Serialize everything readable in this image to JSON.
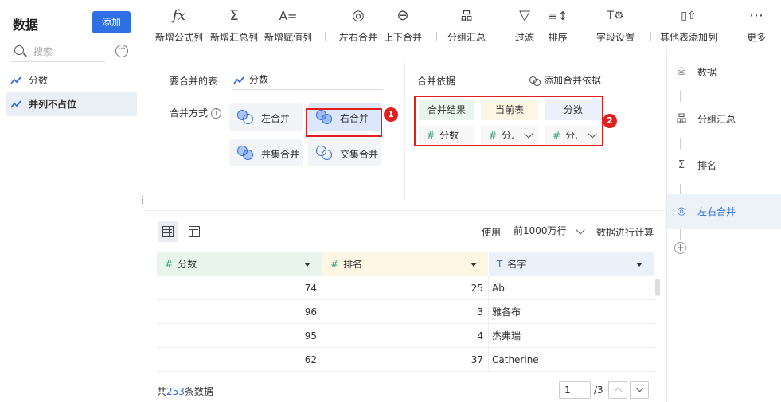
{
  "left_panel": {
    "title": "数据",
    "add_label": "添加",
    "search_placeholder": "搜索",
    "items": [
      {
        "label": "分数",
        "selected": false
      },
      {
        "label": "并列不占位",
        "selected": true
      }
    ]
  },
  "toolbar": {
    "items": [
      {
        "icon": "function-icon",
        "glyph": "fx",
        "label": "新增公式列"
      },
      {
        "icon": "sigma-icon",
        "glyph": "Σ",
        "label": "新增汇总列"
      },
      {
        "icon": "assign-value-icon",
        "glyph": "A=",
        "label": "新增赋值列"
      },
      {
        "icon": "left-right-merge-icon",
        "glyph": "◎",
        "label": "左右合并"
      },
      {
        "icon": "up-down-merge-icon",
        "glyph": "⊖",
        "label": "上下合并"
      },
      {
        "icon": "group-summary-icon",
        "glyph": "品",
        "label": "分组汇总"
      },
      {
        "icon": "filter-icon",
        "glyph": "▽",
        "label": "过滤"
      },
      {
        "icon": "sort-icon",
        "glyph": "≡↕",
        "label": "排序"
      },
      {
        "icon": "field-settings-icon",
        "glyph": "T⚙",
        "label": "字段设置"
      },
      {
        "icon": "add-column-from-other-table-icon",
        "glyph": "▯⇧",
        "label": "其他表添加列"
      },
      {
        "icon": "more-icon",
        "glyph": "⋯",
        "label": "更多"
      }
    ]
  },
  "merge_config": {
    "table_label": "要合并的表",
    "table_value": "分数",
    "mode_label": "合并方式",
    "modes": [
      {
        "label": "左合并",
        "selected": false
      },
      {
        "label": "右合并",
        "selected": true
      },
      {
        "label": "并集合并",
        "selected": false
      },
      {
        "label": "交集合并",
        "selected": false
      }
    ],
    "basis_label": "合并依据",
    "add_basis_label": "添加合并依据",
    "basis_headers": [
      "合并结果",
      "当前表",
      "分数"
    ],
    "basis_row": [
      "分数",
      "分.",
      "分."
    ],
    "header_colors": [
      "#e8f5ec",
      "#fdf6e3",
      "#eaf1fb"
    ],
    "badges": [
      "1",
      "2"
    ]
  },
  "preview": {
    "use_label": "使用",
    "rows_option": "前1000万行",
    "compute_label": "数据进行计算",
    "columns": [
      {
        "name": "分数",
        "type_icon": "#",
        "header_color": "#e8f5ec"
      },
      {
        "name": "排名",
        "type_icon": "#",
        "header_color": "#fdf6e3"
      },
      {
        "name": "名字",
        "type_icon": "T",
        "header_color": "#eaf1fb"
      }
    ],
    "rows": [
      [
        "74",
        "25",
        "Abi"
      ],
      [
        "96",
        "3",
        "雅各布"
      ],
      [
        "95",
        "4",
        "杰弗瑞"
      ],
      [
        "62",
        "37",
        "Catherine"
      ]
    ],
    "footer_prefix": "共",
    "total_count": "253",
    "footer_suffix": "条数据",
    "page_current": "1",
    "page_total": "/3"
  },
  "steps": {
    "items": [
      {
        "glyph": "⛁",
        "icon": "database-icon",
        "label": "数据",
        "active": false
      },
      {
        "glyph": "品",
        "icon": "group-summary-icon",
        "label": "分组汇总",
        "active": false
      },
      {
        "glyph": "Σ",
        "icon": "sigma-icon",
        "label": "排名",
        "active": false
      },
      {
        "glyph": "◎",
        "icon": "left-right-merge-icon",
        "label": "左右合并",
        "active": true
      }
    ],
    "add_glyph": "+"
  },
  "colors": {
    "accent": "#2f6fe4",
    "highlight_red": "#e02020",
    "number_type": "#35a27b"
  }
}
